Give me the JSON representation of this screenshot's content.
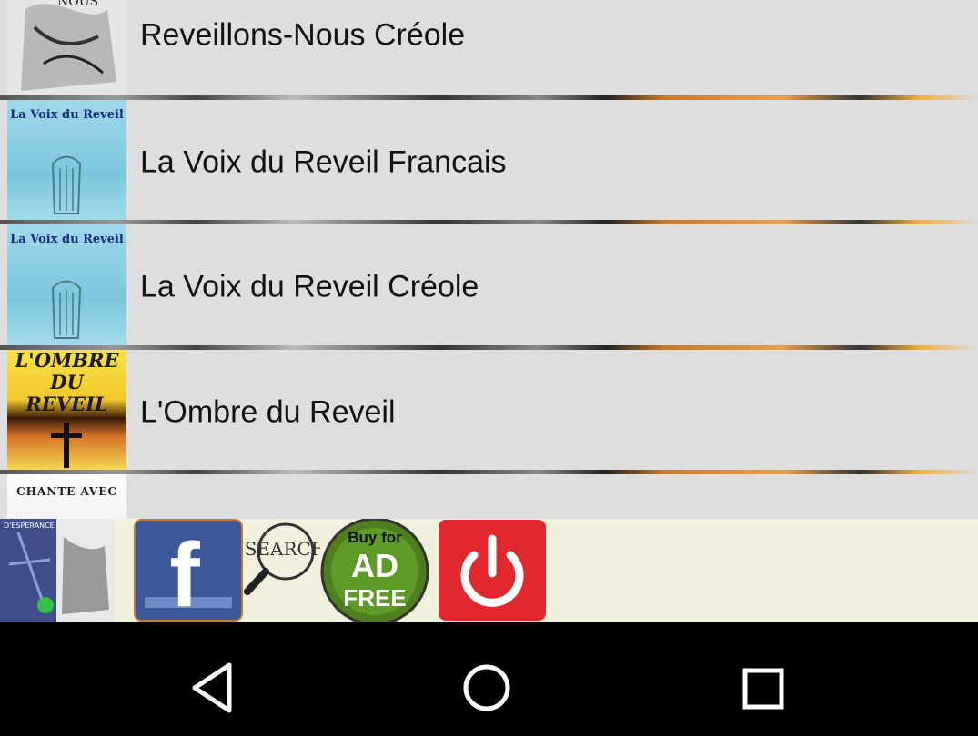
{
  "songbooks": [
    {
      "title": "Reveillons-Nous Créole",
      "cover_text": "NOUS"
    },
    {
      "title": "La Voix du Reveil Francais",
      "cover_text": "La Voix du Reveil"
    },
    {
      "title": "La Voix du Reveil Créole",
      "cover_text": "La Voix du Reveil"
    },
    {
      "title": "L'Ombre du Reveil",
      "cover_lines": [
        "L'OMBRE",
        "DU",
        "REVEIL"
      ]
    },
    {
      "title": "",
      "cover_text": "CHANTE AVEC"
    }
  ],
  "toolbar": {
    "app_cover_text": "D'ESPERANCE REVEILLONS NOUS",
    "facebook_label": "f",
    "search_label": "SEARCH",
    "ad_free_label": [
      "Buy for",
      "AD",
      "FREE"
    ],
    "icons": [
      "app-cover-icon",
      "facebook-icon",
      "search-icon",
      "ad-free-icon",
      "power-icon"
    ]
  },
  "navbar": {
    "icons": [
      "back-icon",
      "home-icon",
      "recents-icon"
    ]
  },
  "colors": {
    "list_bg": "#dedede",
    "toolbar_bg": "#f2f1dd",
    "facebook_blue": "#3b5998",
    "power_red": "#e0282e",
    "ad_green": "#4e7e1e"
  }
}
